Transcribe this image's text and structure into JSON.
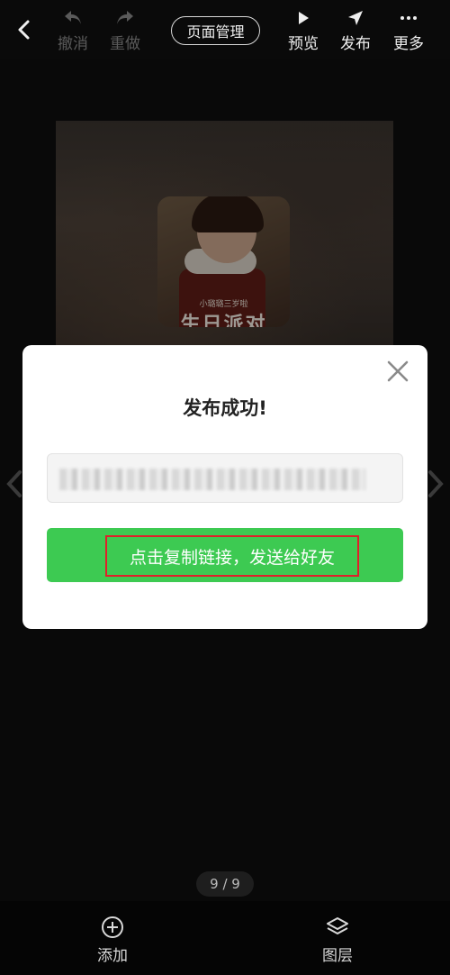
{
  "toolbar": {
    "undo_label": "撤消",
    "redo_label": "重做",
    "page_manage_label": "页面管理",
    "preview_label": "预览",
    "publish_label": "发布",
    "more_label": "更多"
  },
  "canvas": {
    "photo_small_text": "小璐璐三岁啦",
    "photo_big_text": "生日派对"
  },
  "dialog": {
    "title": "发布成功!",
    "copy_button_label": "点击复制链接，发送给好友"
  },
  "pager": {
    "indicator": "9 / 9"
  },
  "bottombar": {
    "add_label": "添加",
    "layers_label": "图层"
  },
  "colors": {
    "accent_green": "#3dca52",
    "highlight_red": "#e0202a",
    "background": "#0e0e0e"
  }
}
